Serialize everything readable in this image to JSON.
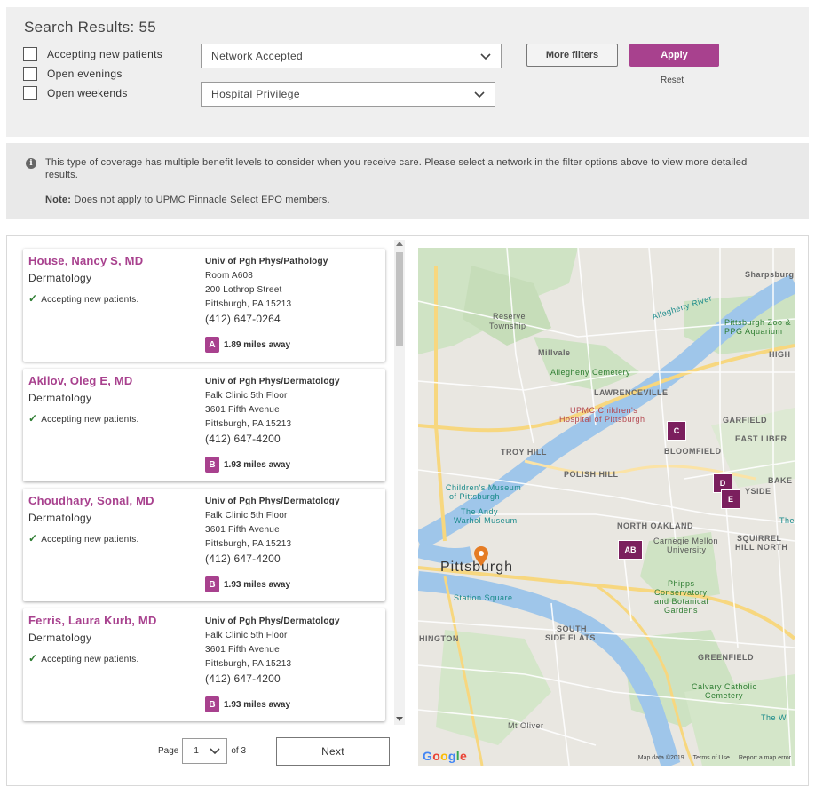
{
  "filters": {
    "title": "Search Results: 55",
    "checkboxes": [
      {
        "label": "Accepting new patients"
      },
      {
        "label": "Open evenings"
      },
      {
        "label": "Open weekends"
      }
    ],
    "network_select": "Network Accepted",
    "hospital_select": "Hospital Privilege",
    "more_filters_label": "More filters",
    "apply_label": "Apply",
    "reset_label": "Reset"
  },
  "banner": {
    "info_icon": "info-icon",
    "message": "This type of coverage has multiple benefit levels to consider when you receive care. Please select a network in the filter options above to view more detailed results.",
    "note_label": "Note:",
    "note_text": " Does not apply to UPMC Pinnacle Select EPO members."
  },
  "results": [
    {
      "name": "House, Nancy S, MD",
      "specialty": "Dermatology",
      "accepting": "Accepting new patients.",
      "practice": "Univ of Pgh Phys/Pathology",
      "line1": "Room A608",
      "line2": "200 Lothrop Street",
      "city": "Pittsburgh, PA 15213",
      "phone": "(412) 647-0264",
      "badge": "A",
      "distance": "1.89 miles away"
    },
    {
      "name": "Akilov, Oleg E, MD",
      "specialty": "Dermatology",
      "accepting": "Accepting new patients.",
      "practice": "Univ of Pgh Phys/Dermatology",
      "line1": "Falk Clinic 5th Floor",
      "line2": "3601 Fifth Avenue",
      "city": "Pittsburgh, PA 15213",
      "phone": "(412) 647-4200",
      "badge": "B",
      "distance": "1.93 miles away"
    },
    {
      "name": "Choudhary, Sonal, MD",
      "specialty": "Dermatology",
      "accepting": "Accepting new patients.",
      "practice": "Univ of Pgh Phys/Dermatology",
      "line1": "Falk Clinic 5th Floor",
      "line2": "3601 Fifth Avenue",
      "city": "Pittsburgh, PA 15213",
      "phone": "(412) 647-4200",
      "badge": "B",
      "distance": "1.93 miles away"
    },
    {
      "name": "Ferris, Laura Kurb, MD",
      "specialty": "Dermatology",
      "accepting": "Accepting new patients.",
      "practice": "Univ of Pgh Phys/Dermatology",
      "line1": "Falk Clinic 5th Floor",
      "line2": "3601 Fifth Avenue",
      "city": "Pittsburgh, PA 15213",
      "phone": "(412) 647-4200",
      "badge": "B",
      "distance": "1.93 miles away"
    }
  ],
  "pager": {
    "page_label": "Page",
    "current": "1",
    "of_label": "of 3",
    "next_label": "Next"
  },
  "map": {
    "city_label": "Pittsburgh",
    "labels": {
      "sharpsburg": "Sharpsburg",
      "reserve": "Reserve",
      "township": "Township",
      "millvale": "Millvale",
      "allegheny_river": "Allegheny River",
      "zoo": "Pittsburgh Zoo &",
      "aquarium": "PPG Aquarium",
      "cemetery": "Allegheny Cemetery",
      "lawrenceville": "LAWRENCEVILLE",
      "childrens_hospital_1": "UPMC Children's",
      "childrens_hospital_2": "Hospital of Pittsburgh",
      "garfield": "GARFIELD",
      "east_liberty": "EAST LIBER",
      "bloomfield": "BLOOMFIELD",
      "troy_hill": "TROY HILL",
      "polish_hill": "POLISH HILL",
      "museum_1": "Children's Museum",
      "museum_2": "of Pittsburgh",
      "warhol_1": "The Andy",
      "warhol_2": "Warhol Museum",
      "north_oakland": "NORTH OAKLAND",
      "cmu_1": "Carnegie Mellon",
      "cmu_2": "University",
      "squirrel_1": "SQUIRREL",
      "squirrel_2": "HILL NORTH",
      "phipps_1": "Phipps",
      "phipps_2": "Conservatory",
      "phipps_3": "and Botanical",
      "phipps_4": "Gardens",
      "station_square": "Station Square",
      "south_side_1": "SOUTH",
      "south_side_2": "SIDE FLATS",
      "hington": "HINGTON",
      "greenfield": "GREENFIELD",
      "calvary_1": "Calvary Catholic",
      "calvary_2": "Cemetery",
      "mt_oliver": "Mt Oliver",
      "high": "HIGH",
      "baker": "BAKE",
      "yside": "YSIDE",
      "the_w": "The W",
      "the": "The"
    },
    "pins": [
      "C",
      "D",
      "E",
      "AB"
    ],
    "google": "Google",
    "footer": [
      "Map data ©2019",
      "Terms of Use",
      "Report a map error"
    ]
  },
  "colors": {
    "accent": "#a8418e",
    "pin": "#7b1f5e",
    "check": "#2e7d32"
  }
}
